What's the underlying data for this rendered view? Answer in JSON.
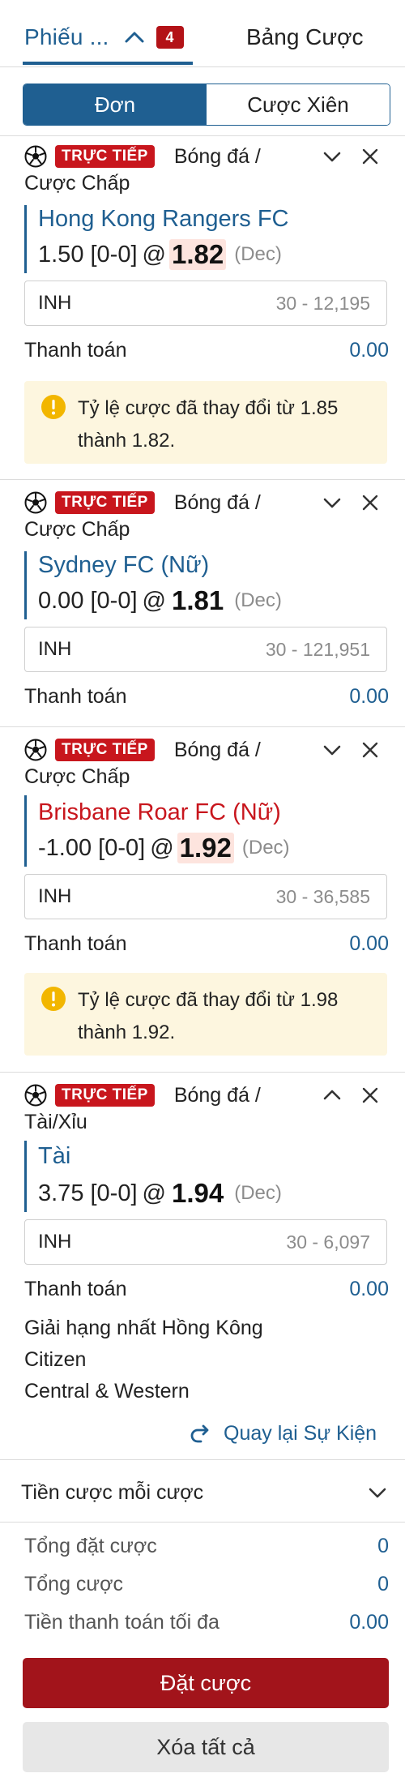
{
  "tabs": {
    "bet_slip_label": "Phiếu ...",
    "bet_slip_count": "4",
    "bet_board_label": "Bảng Cược"
  },
  "mode_toggle": {
    "single": "Đơn",
    "parlay": "Cược Xiên"
  },
  "icons": {
    "collapse": "chevron-up-icon",
    "expand": "chevron-down-icon",
    "remove": "close-icon",
    "sport": "soccer-ball-icon",
    "warning": "warning-icon",
    "back": "back-arrow-icon"
  },
  "colors": {
    "accent": "#1f5f91",
    "live": "#c8161d",
    "place_button": "#a2141b",
    "warning_bg": "#fdf6df",
    "odds_highlight": "#fde4de"
  },
  "bets": [
    {
      "live_label": "TRỰC TIẾP",
      "sport": "Bóng đá /",
      "market": "Cược Chấp",
      "team": "Hong Kong Rangers FC",
      "line": "1.50 [0-0]",
      "at": "@",
      "odds": "1.82",
      "odds_format": "(Dec)",
      "stake_currency": "INH",
      "stake_limits": "30 - 12,195",
      "payout_label": "Thanh toán",
      "payout_value": "0.00",
      "warning": "Tỷ lệ cược đã thay đổi từ 1.85 thành 1.82."
    },
    {
      "live_label": "TRỰC TIẾP",
      "sport": "Bóng đá /",
      "market": "Cược Chấp",
      "team": "Sydney FC (Nữ)",
      "line": "0.00 [0-0]",
      "at": "@",
      "odds": "1.81",
      "odds_format": "(Dec)",
      "stake_currency": "INH",
      "stake_limits": "30 - 121,951",
      "payout_label": "Thanh toán",
      "payout_value": "0.00"
    },
    {
      "live_label": "TRỰC TIẾP",
      "sport": "Bóng đá /",
      "market": "Cược Chấp",
      "team": "Brisbane Roar FC (Nữ)",
      "line": "-1.00 [0-0]",
      "at": "@",
      "odds": "1.92",
      "odds_format": "(Dec)",
      "stake_currency": "INH",
      "stake_limits": "30 - 36,585",
      "payout_label": "Thanh toán",
      "payout_value": "0.00",
      "warning": "Tỷ lệ cược đã thay đổi từ 1.98 thành 1.92."
    },
    {
      "live_label": "TRỰC TIẾP",
      "sport": "Bóng đá /",
      "market": "Tài/Xỉu",
      "team": "Tài",
      "line": "3.75 [0-0]",
      "at": "@",
      "odds": "1.94",
      "odds_format": "(Dec)",
      "stake_currency": "INH",
      "stake_limits": "30 - 6,097",
      "payout_label": "Thanh toán",
      "payout_value": "0.00",
      "details": [
        "Giải hạng nhất Hồng Kông",
        "Citizen",
        "Central & Western"
      ],
      "back_link": "Quay lại Sự Kiện"
    }
  ],
  "per_bet_stake": "Tiền cược mỗi cược",
  "summary": {
    "total_stake_label": "Tổng đặt cược",
    "total_stake_value": "0",
    "total_bets_label": "Tổng cược",
    "total_bets_value": "0",
    "max_payout_label": "Tiền thanh toán tối đa",
    "max_payout_value": "0.00"
  },
  "buttons": {
    "place_bet": "Đặt cược",
    "clear_all": "Xóa tất cả"
  }
}
